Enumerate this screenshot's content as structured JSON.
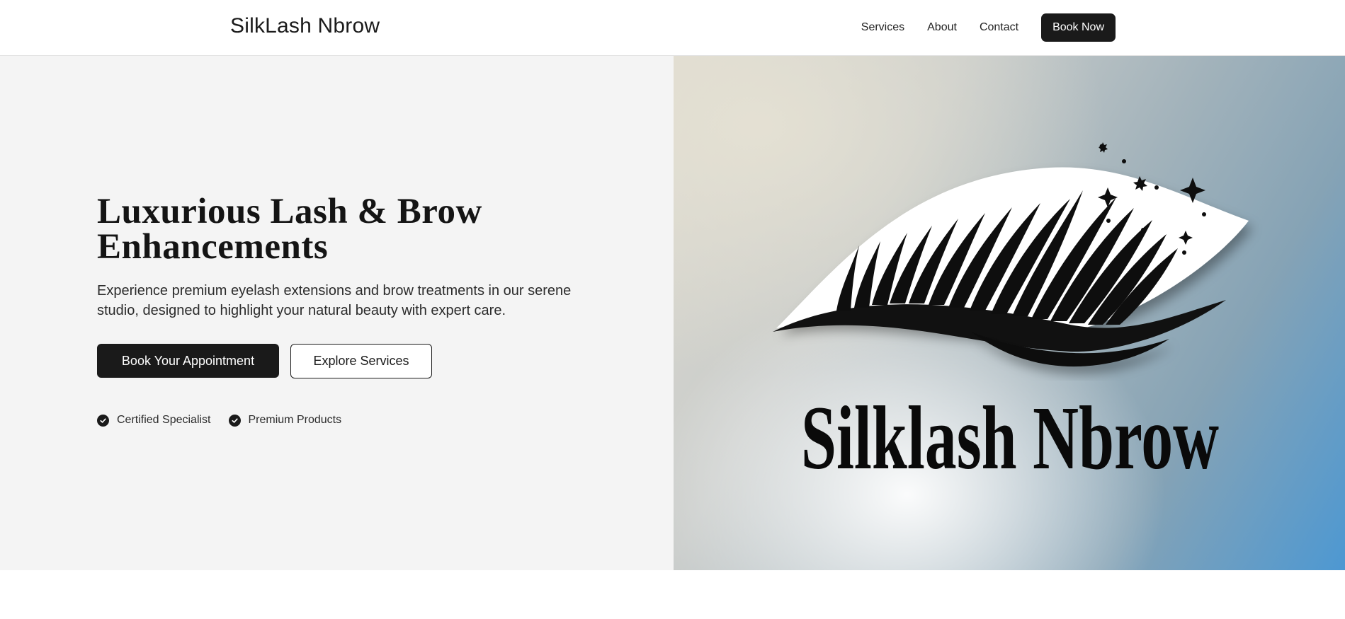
{
  "header": {
    "brand": "SilkLash Nbrow",
    "nav": {
      "services": "Services",
      "about": "About",
      "contact": "Contact",
      "book_now": "Book Now"
    }
  },
  "hero": {
    "title": "Luxurious Lash & Brow Enhancements",
    "description": "Experience premium eyelash extensions and brow treatments in our serene studio, designed to highlight your natural beauty with expert care.",
    "primary_button": "Book Your Appointment",
    "secondary_button": "Explore Services",
    "features": [
      {
        "label": "Certified Specialist",
        "icon": "check-circle-icon"
      },
      {
        "label": "Premium Products",
        "icon": "check-circle-icon"
      }
    ],
    "logo_text": "Silklash Nbrow"
  },
  "colors": {
    "dark": "#1a1a1a",
    "hero_left_bg": "#f4f4f4",
    "accent_blue": "#4d98d2"
  }
}
